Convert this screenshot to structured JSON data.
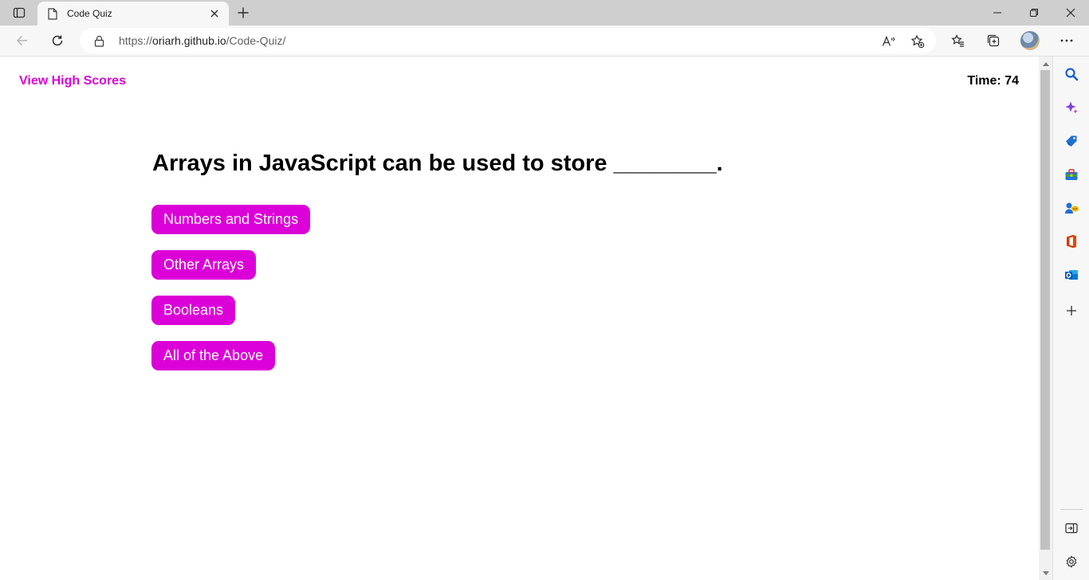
{
  "browser": {
    "tab_title": "Code Quiz",
    "url_prefix": "https://",
    "url_host": "oriarh.github.io",
    "url_path": "/Code-Quiz/"
  },
  "page": {
    "high_scores_link": "View High Scores",
    "timer_label": "Time:",
    "timer_value": "74",
    "question": "Arrays in JavaScript can be used to store ________.",
    "answers": [
      "Numbers and Strings",
      "Other Arrays",
      "Booleans",
      "All of the Above"
    ]
  },
  "colors": {
    "accent": "#dc00d8",
    "titlebar": "#cfcfcf",
    "toolbar": "#f7f7f7"
  },
  "icons": {
    "tab_actions": "tab-actions-icon",
    "new_tab": "plus-icon",
    "back": "back-arrow-icon",
    "refresh": "refresh-icon",
    "lock": "lock-icon",
    "read_aloud": "read-aloud-icon",
    "add_favorite": "add-favorite-icon",
    "favorites": "favorites-icon",
    "collections": "collections-icon",
    "profile": "profile-avatar",
    "more": "more-icon",
    "sidebar": [
      "search-icon",
      "copilot-icon",
      "shopping-icon",
      "tools-icon",
      "games-icon",
      "office-icon",
      "outlook-icon",
      "add-icon",
      "hide-sidebar-icon",
      "settings-icon"
    ]
  }
}
